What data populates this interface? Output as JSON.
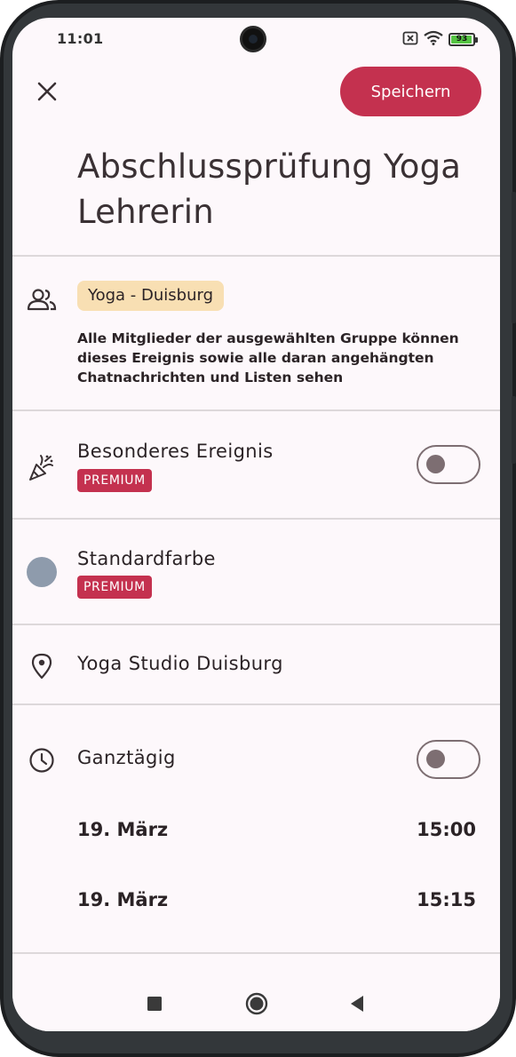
{
  "status_bar": {
    "time": "11:01",
    "battery_level": "93",
    "battery_color": "#55c443",
    "icons": [
      "sim-off-icon",
      "wifi-icon",
      "battery-icon"
    ]
  },
  "header": {
    "close_icon": "close-icon",
    "save_label": "Speichern",
    "accent_color": "#c4314f"
  },
  "event": {
    "title": "Abschlussprüfung Yoga Lehrerin"
  },
  "group": {
    "icon": "people-icon",
    "name": "Yoga - Duisburg",
    "description": "Alle Mitglieder der ausgewählten Gruppe können dieses Ereignis sowie alle daran angehängten Chatnachrichten und Listen sehen"
  },
  "special_event": {
    "icon": "party-popper-icon",
    "label": "Besonderes Ereignis",
    "badge": "PREMIUM",
    "enabled": false
  },
  "color": {
    "label": "Standardfarbe",
    "badge": "PREMIUM",
    "swatch": "#8e9bac"
  },
  "location": {
    "icon": "location-pin-icon",
    "value": "Yoga Studio Duisburg"
  },
  "all_day": {
    "icon": "clock-icon",
    "label": "Ganztägig",
    "enabled": false
  },
  "start": {
    "date": "19. März",
    "time": "15:00"
  },
  "end": {
    "date": "19. März",
    "time": "15:15"
  },
  "nav_bar": {
    "icons": [
      "recents-square-icon",
      "home-circle-icon",
      "back-triangle-icon"
    ]
  }
}
